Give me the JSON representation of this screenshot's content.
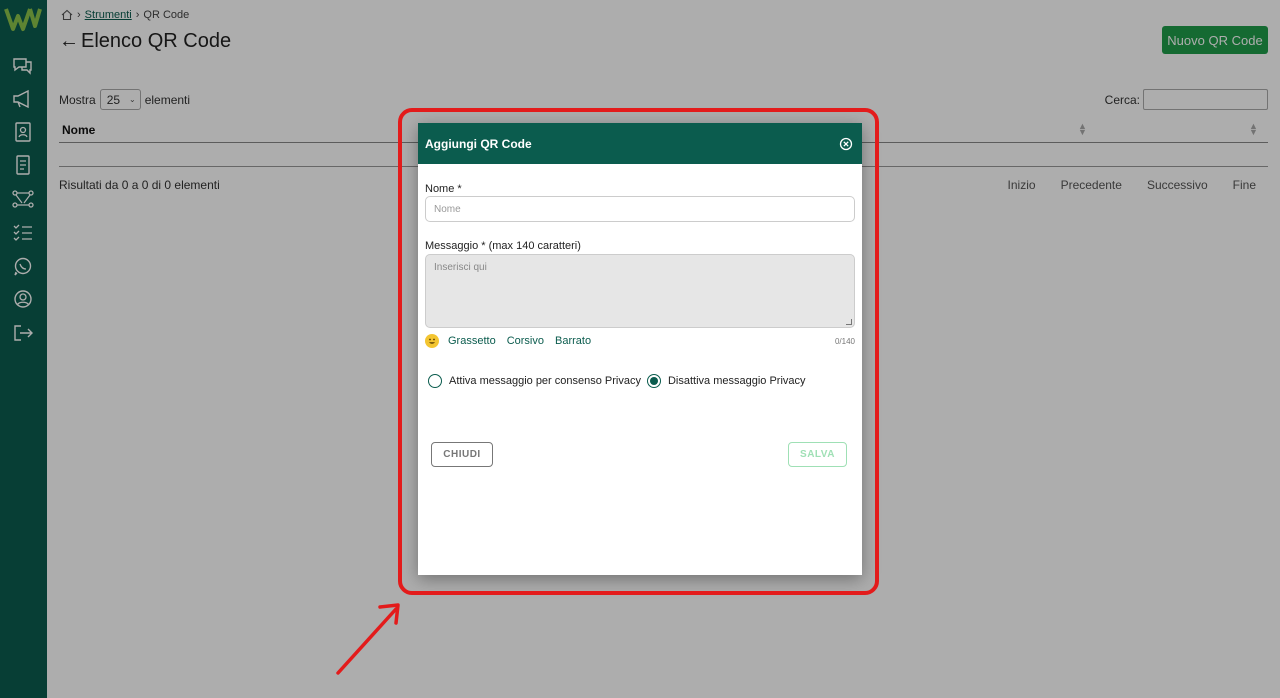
{
  "sidebar": {
    "logo": "W",
    "icons": [
      "chat-icon",
      "megaphone-icon",
      "contacts-icon",
      "document-icon",
      "flow-icon",
      "checklist-icon",
      "whatsapp-icon",
      "user-icon",
      "logout-icon"
    ]
  },
  "breadcrumb": {
    "home_icon": "home-icon",
    "link": "Strumenti",
    "current": "QR Code"
  },
  "page": {
    "title": "Elenco QR Code",
    "new_button": "Nuovo QR Code"
  },
  "table": {
    "length_prefix": "Mostra",
    "length_value": "25",
    "length_suffix": "elementi",
    "search_label": "Cerca:",
    "column_name": "Nome",
    "info": "Risultati da 0 a 0 di 0 elementi",
    "paging": [
      "Inizio",
      "Precedente",
      "Successivo",
      "Fine"
    ]
  },
  "modal": {
    "title": "Aggiungi QR Code",
    "name_label": "Nome *",
    "name_placeholder": "Nome",
    "message_label": "Messaggio * (max 140 caratteri)",
    "message_placeholder": "Inserisci qui",
    "format": {
      "bold": "Grassetto",
      "italic": "Corsivo",
      "strike": "Barrato"
    },
    "counter": "0/140",
    "radio_enable": "Attiva messaggio per consenso Privacy",
    "radio_disable": "Disattiva messaggio Privacy",
    "selected_radio": "disable",
    "close_button": "CHIUDI",
    "save_button": "SALVA"
  },
  "colors": {
    "brand": "#0b5c4e",
    "accent": "#1f9d4a",
    "highlight": "#e31b1b"
  }
}
